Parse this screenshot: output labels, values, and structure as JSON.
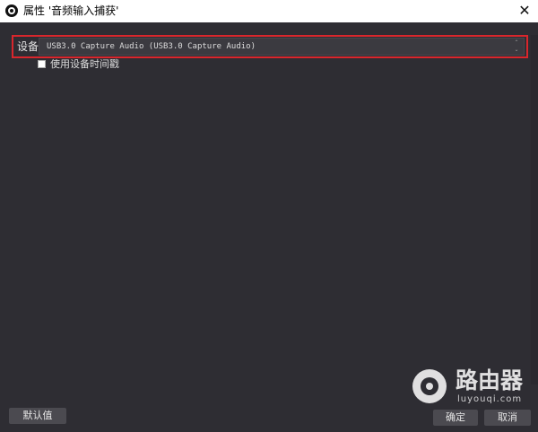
{
  "window": {
    "title": "属性 '音频输入捕获'",
    "close_glyph": "✕"
  },
  "device": {
    "label": "设备",
    "selected": "USB3.0 Capture Audio (USB3.0 Capture Audio)",
    "arrows": "⌃⌄"
  },
  "timestamp_option": {
    "label": "使用设备时间戳",
    "checked": false
  },
  "buttons": {
    "defaults": "默认值",
    "ok": "确定",
    "cancel": "取消"
  },
  "watermark": {
    "title": "路由器",
    "subtitle": "luyouqi.com"
  },
  "colors": {
    "background": "#2e2d33",
    "highlight_border": "#d9262c"
  }
}
